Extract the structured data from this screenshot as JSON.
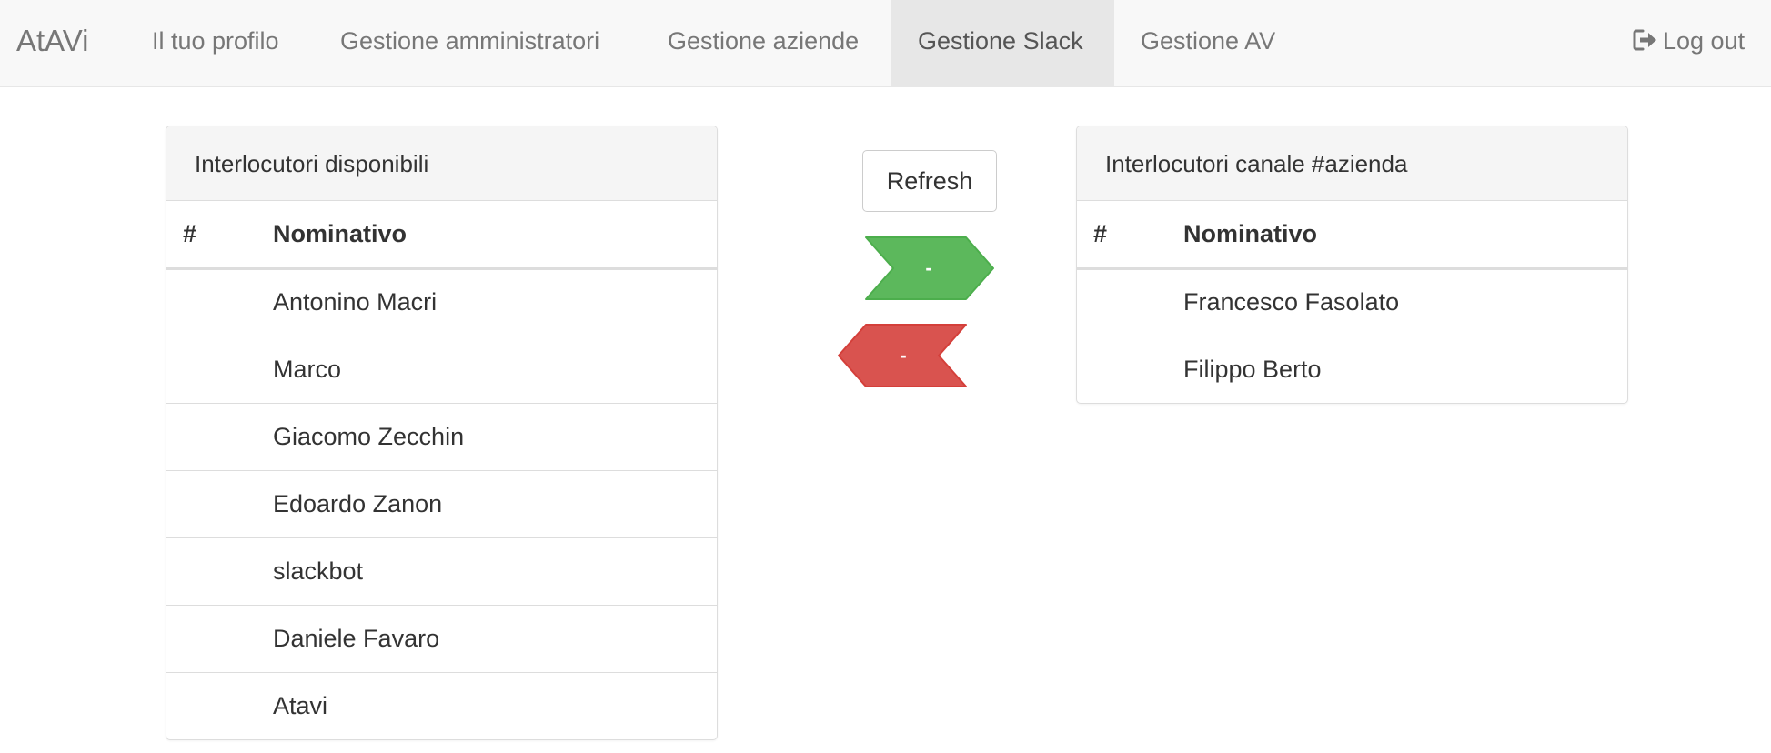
{
  "navbar": {
    "brand": "AtAVi",
    "links": [
      {
        "label": "Il tuo profilo"
      },
      {
        "label": "Gestione amministratori"
      },
      {
        "label": "Gestione aziende"
      },
      {
        "label": "Gestione Slack"
      },
      {
        "label": "Gestione AV"
      }
    ],
    "active_index": 3,
    "logout": {
      "label": "Log out",
      "icon": "log-out-icon"
    }
  },
  "available_panel": {
    "title": "Interlocutori disponibili",
    "columns": [
      "#",
      "Nominativo"
    ],
    "rows": [
      {
        "num": "",
        "name": "Antonino Macri"
      },
      {
        "num": "",
        "name": "Marco"
      },
      {
        "num": "",
        "name": "Giacomo Zecchin"
      },
      {
        "num": "",
        "name": "Edoardo Zanon"
      },
      {
        "num": "",
        "name": "slackbot"
      },
      {
        "num": "",
        "name": "Daniele Favaro"
      },
      {
        "num": "",
        "name": "Atavi"
      }
    ]
  },
  "channel_panel": {
    "title": "Interlocutori canale #azienda",
    "columns": [
      "#",
      "Nominativo"
    ],
    "rows": [
      {
        "num": "",
        "name": "Francesco Fasolato"
      },
      {
        "num": "",
        "name": "Filippo Berto"
      }
    ]
  },
  "controls": {
    "refresh_label": "Refresh",
    "add_arrow": {
      "label": "-",
      "color": "#5cb85c",
      "border": "#4cae4c",
      "icon": "arrow-right-icon"
    },
    "remove_arrow": {
      "label": "-",
      "color": "#d9534f",
      "border": "#d43f3a",
      "icon": "arrow-left-icon"
    }
  }
}
